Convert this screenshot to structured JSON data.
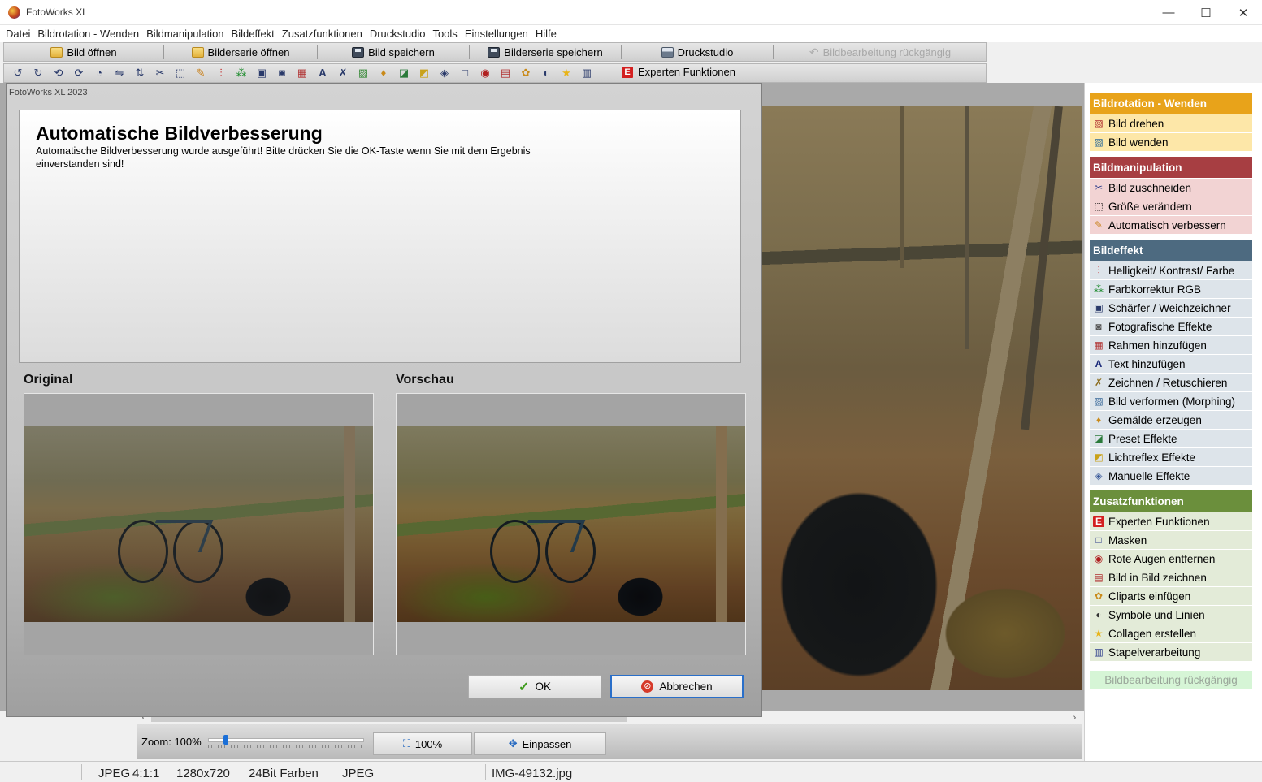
{
  "window": {
    "title": "FotoWorks XL"
  },
  "menu": [
    "Datei",
    "Bildrotation - Wenden",
    "Bildmanipulation",
    "Bildeffekt",
    "Zusatzfunktionen",
    "Druckstudio",
    "Tools",
    "Einstellungen",
    "Hilfe"
  ],
  "toolbar": {
    "open": "Bild öffnen",
    "open_series": "Bilderserie öffnen",
    "save": "Bild speichern",
    "save_series": "Bilderserie speichern",
    "print_studio": "Druckstudio",
    "undo": "Bildbearbeitung rückgängig"
  },
  "toolbar2": {
    "expert_badge": "E",
    "expert": "Experten Funktionen"
  },
  "dialog": {
    "window_title": "FotoWorks XL 2023",
    "heading": "Automatische Bildverbesserung",
    "message": "Automatische Bildverbesserung wurde ausgeführt! Bitte drücken Sie die OK-Taste wenn Sie mit dem Ergebnis einverstanden sind!",
    "original_label": "Original",
    "preview_label": "Vorschau",
    "ok": "OK",
    "cancel": "Abbrechen"
  },
  "zoom": {
    "label": "Zoom: 100%",
    "level": 0.1,
    "btn_100": "100%",
    "btn_fit": "Einpassen"
  },
  "status": {
    "format": "JPEG",
    "ratio": "4:1:1",
    "size": "1280x720",
    "colors": "24Bit Farben",
    "type": "JPEG",
    "filename": "IMG-49132.jpg"
  },
  "sidebar": {
    "colors": {
      "rotation": "#e8a31a",
      "manipulation": "#a73e42",
      "effect": "#4d6a80",
      "extra": "#6b8f3c"
    },
    "rotation": {
      "title": "Bildrotation - Wenden",
      "items": [
        "Bild drehen",
        "Bild wenden"
      ]
    },
    "manipulation": {
      "title": "Bildmanipulation",
      "items": [
        "Bild zuschneiden",
        "Größe verändern",
        "Automatisch verbessern"
      ]
    },
    "effect": {
      "title": "Bildeffekt",
      "items": [
        "Helligkeit/ Kontrast/ Farbe",
        "Farbkorrektur RGB",
        "Schärfer / Weichzeichner",
        "Fotografische Effekte",
        "Rahmen hinzufügen",
        "Text hinzufügen",
        "Zeichnen / Retuschieren",
        "Bild verformen (Morphing)",
        "Gemälde erzeugen",
        "Preset Effekte",
        "Lichtreflex Effekte",
        "Manuelle Effekte"
      ]
    },
    "extra": {
      "title": "Zusatzfunktionen",
      "items": [
        "Experten Funktionen",
        "Masken",
        "Rote Augen entfernen",
        "Bild in Bild zeichnen",
        "Cliparts einfügen",
        "Symbole und Linien",
        "Collagen erstellen",
        "Stapelverarbeitung"
      ]
    },
    "undo": "Bildbearbeitung rückgängig"
  }
}
